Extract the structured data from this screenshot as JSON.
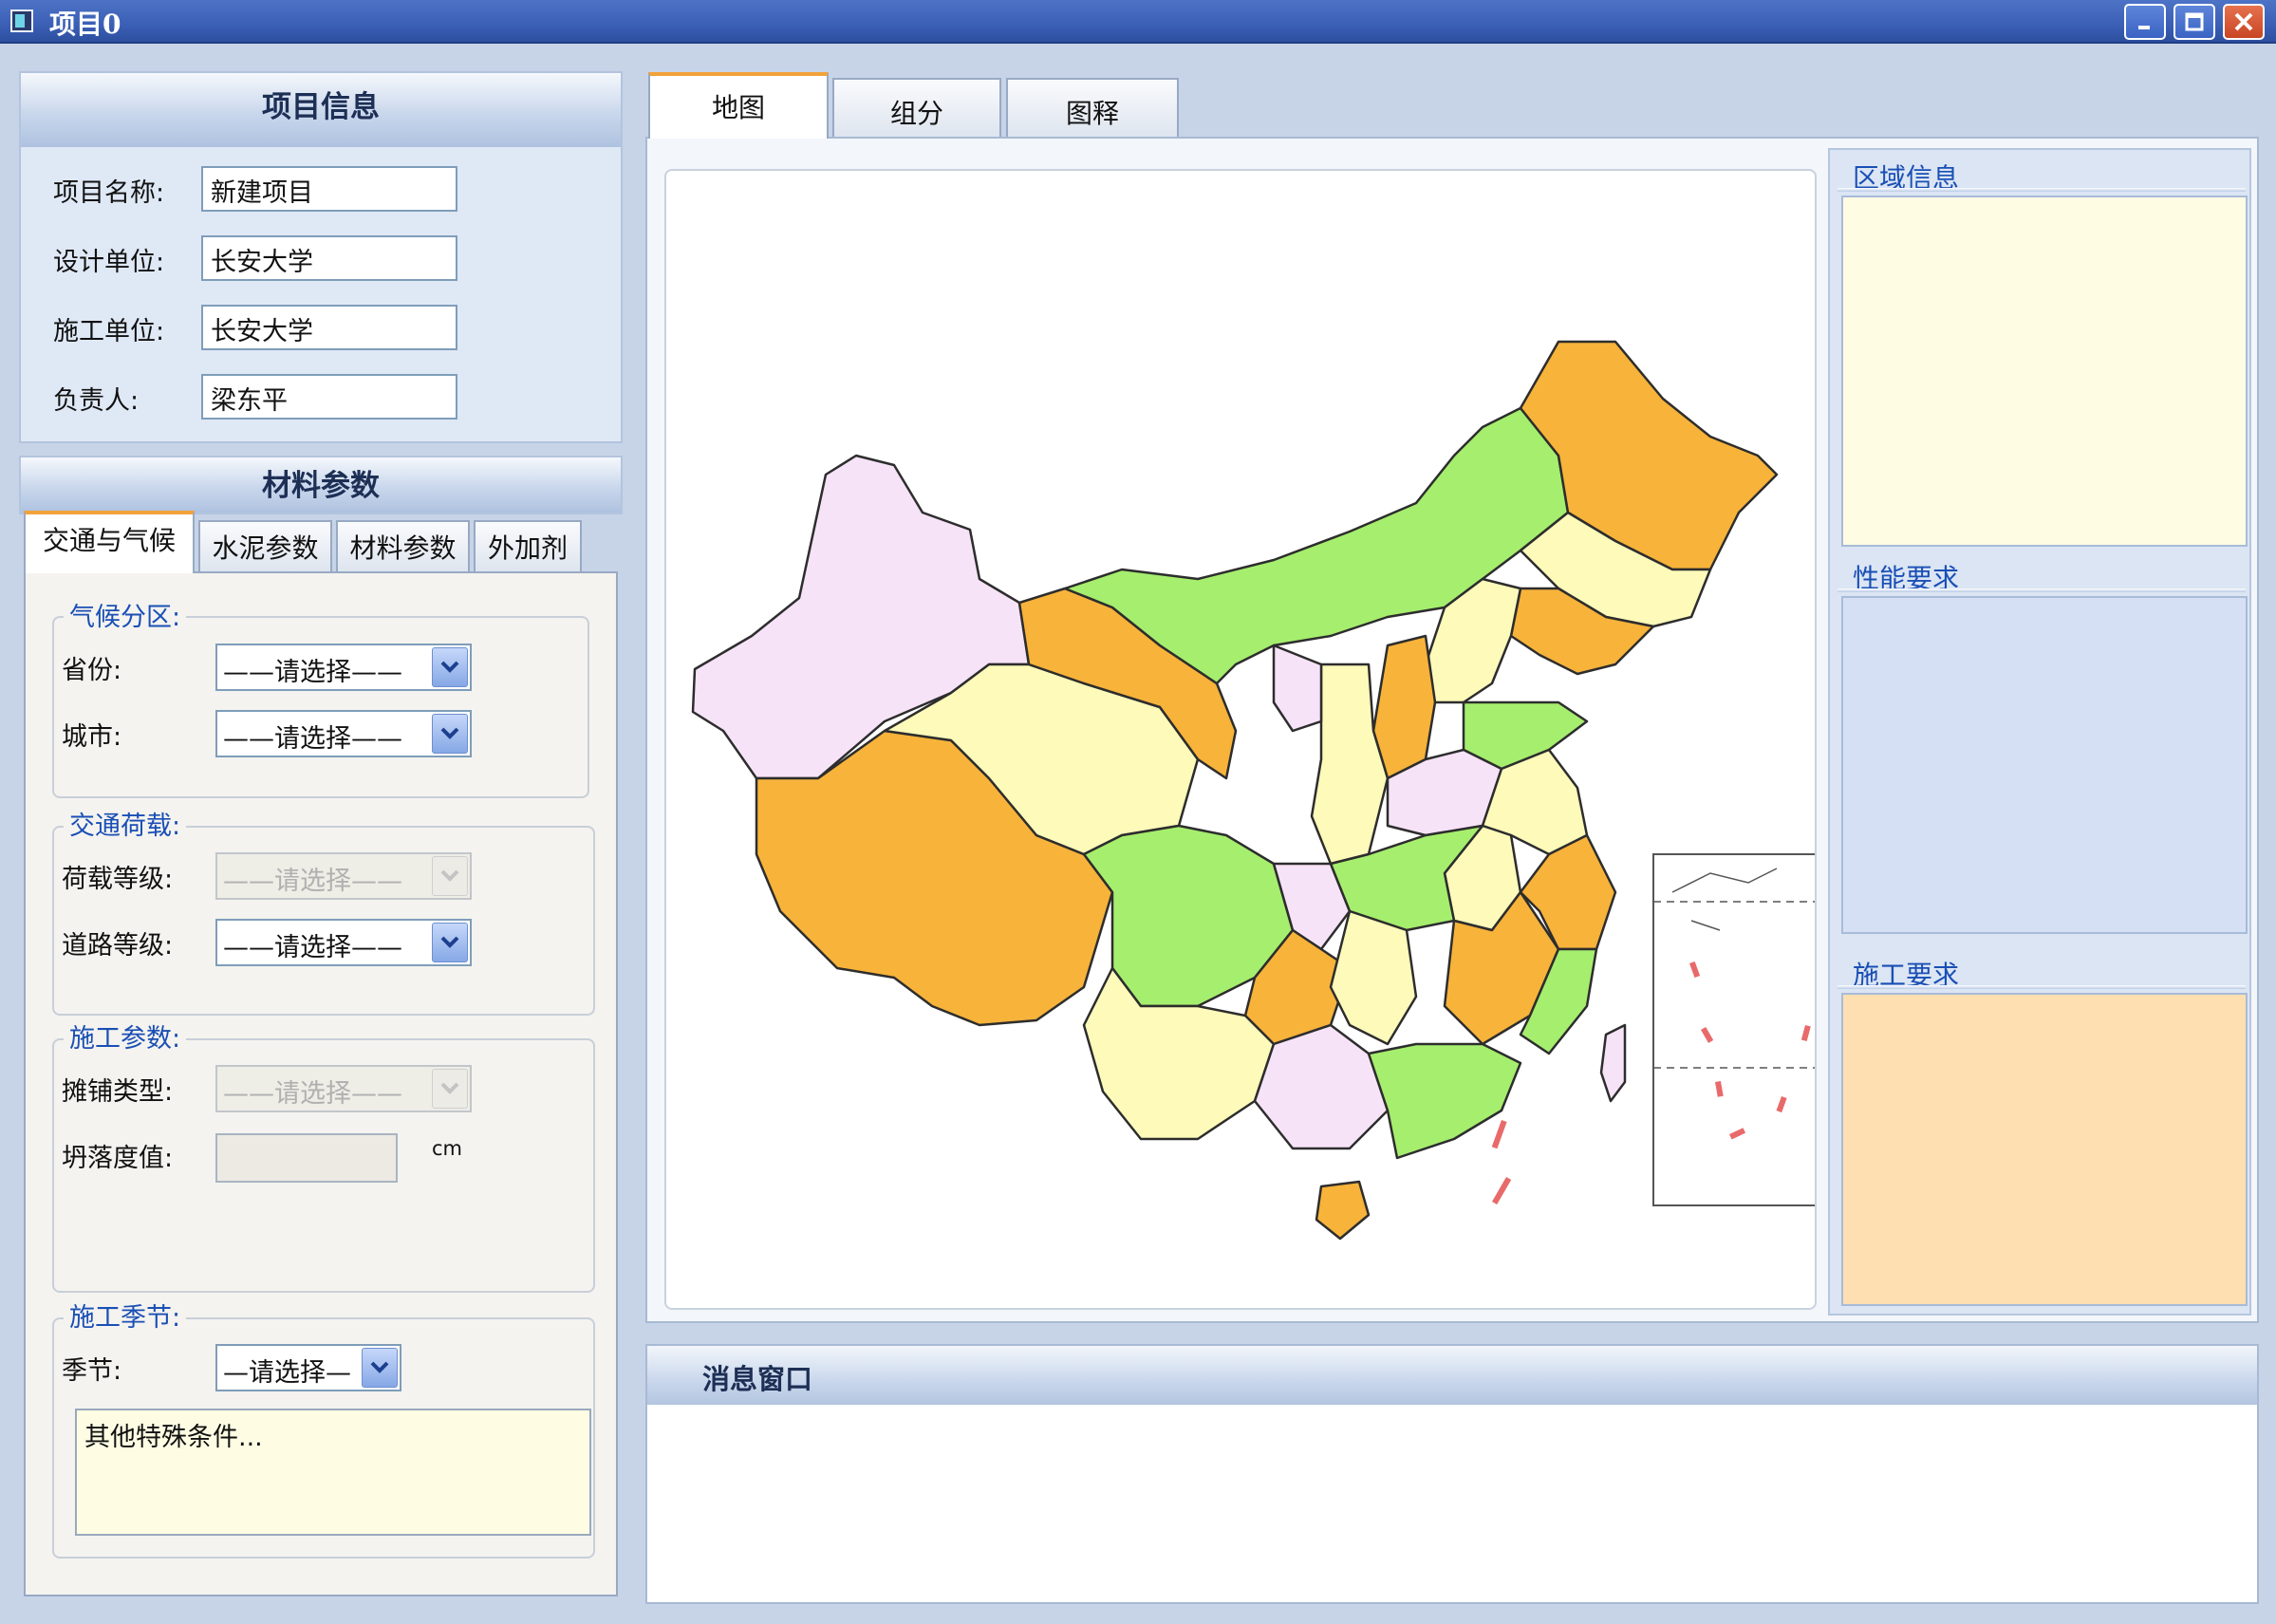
{
  "window": {
    "title": "项目0"
  },
  "project_info": {
    "header": "项目信息",
    "fields": [
      {
        "label": "项目名称:",
        "value": "新建项目"
      },
      {
        "label": "设计单位:",
        "value": "长安大学"
      },
      {
        "label": "施工单位:",
        "value": "长安大学"
      },
      {
        "label": "负责人:",
        "value": "梁东平"
      }
    ]
  },
  "material": {
    "header": "材料参数",
    "tabs": [
      "交通与气候",
      "水泥参数",
      "材料参数",
      "外加剂"
    ],
    "climate": {
      "title": "气候分区:",
      "province_label": "省份:",
      "province_value": "——请选择——",
      "city_label": "城市:",
      "city_value": "——请选择——"
    },
    "traffic": {
      "title": "交通荷载:",
      "load_label": "荷载等级:",
      "load_value": "——请选择——",
      "road_label": "道路等级:",
      "road_value": "——请选择——"
    },
    "construction": {
      "title": "施工参数:",
      "paving_label": "摊铺类型:",
      "paving_value": "——请选择——",
      "slump_label": "坍落度值:",
      "slump_unit": "cm"
    },
    "season": {
      "title": "施工季节:",
      "season_label": "季节:",
      "season_value": "—请选择—",
      "notes": "其他特殊条件..."
    }
  },
  "main_tabs": [
    "地图",
    "组分",
    "图释"
  ],
  "right_panels": [
    "区域信息",
    "性能要求",
    "施工要求"
  ],
  "message": {
    "header": "消息窗口"
  },
  "colors": {
    "orange": "#f7b33a",
    "green": "#a6ee6e",
    "yellow": "#fdfaba",
    "pink": "#f7e3f7",
    "area_info_bg": "#fefde4",
    "performance_bg": "#d5e0f5",
    "construction_bg": "#fddfb2"
  }
}
